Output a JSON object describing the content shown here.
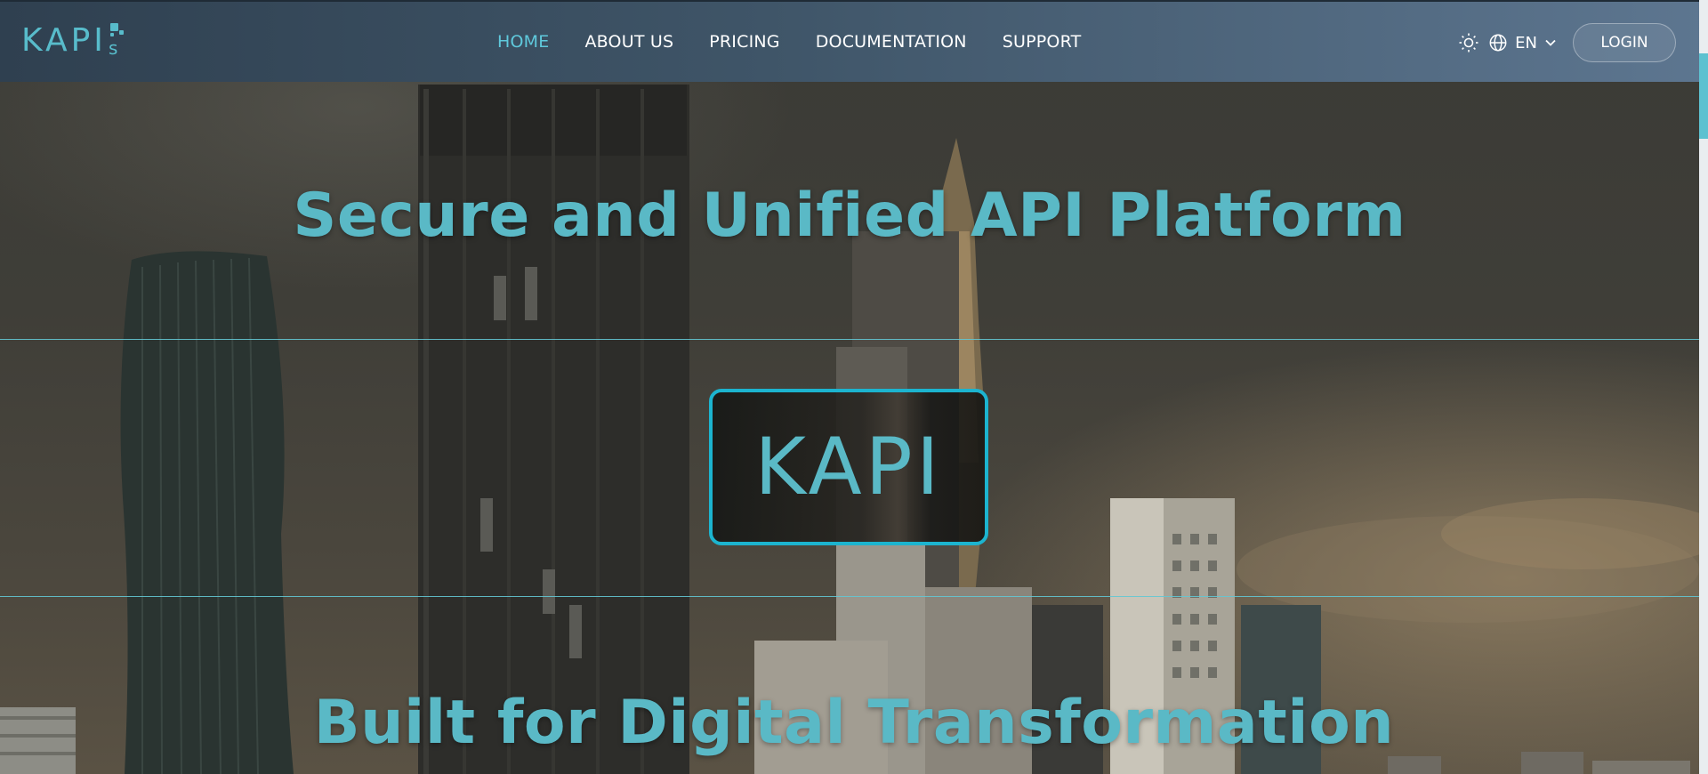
{
  "brand": {
    "logo_text": "KAPI",
    "logo_suffix": "s"
  },
  "nav": {
    "items": [
      {
        "label": "HOME",
        "active": true
      },
      {
        "label": "ABOUT US",
        "active": false
      },
      {
        "label": "PRICING",
        "active": false
      },
      {
        "label": "DOCUMENTATION",
        "active": false
      },
      {
        "label": "SUPPORT",
        "active": false
      }
    ]
  },
  "toolbar": {
    "theme_icon": "sun-icon",
    "language_icon": "globe-icon",
    "language_code": "EN",
    "language_dropdown_icon": "chevron-down-icon",
    "login_label": "LOGIN"
  },
  "hero": {
    "headline_top": "Secure and Unified API Platform",
    "center_label": "KAPI",
    "headline_bottom": "Built for Digital Transformation"
  },
  "colors": {
    "accent": "#5ab9c6",
    "active_nav": "#5fc9dc",
    "box_border": "#1cb4cf",
    "header_start": "#2f4050",
    "header_end": "#5d7690"
  }
}
